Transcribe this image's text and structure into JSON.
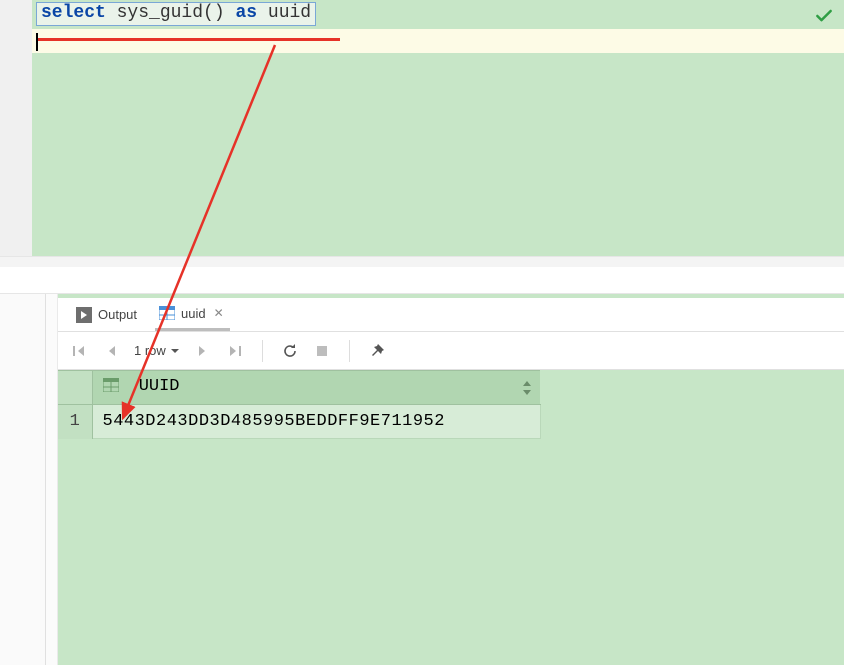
{
  "editor": {
    "sql_tokens": {
      "kw1": "select",
      "sp1": " ",
      "fn": "sys_guid()",
      "sp2": " ",
      "kw2": "as",
      "sp3": " ",
      "alias": "uuid"
    }
  },
  "tabs": {
    "output_label": "Output",
    "result_label": "uuid"
  },
  "toolbar": {
    "row_count": "1 row"
  },
  "result": {
    "column_header": "UUID",
    "rows": [
      {
        "n": "1",
        "value": "5443D243DD3D485995BEDDFF9E711952"
      }
    ]
  }
}
